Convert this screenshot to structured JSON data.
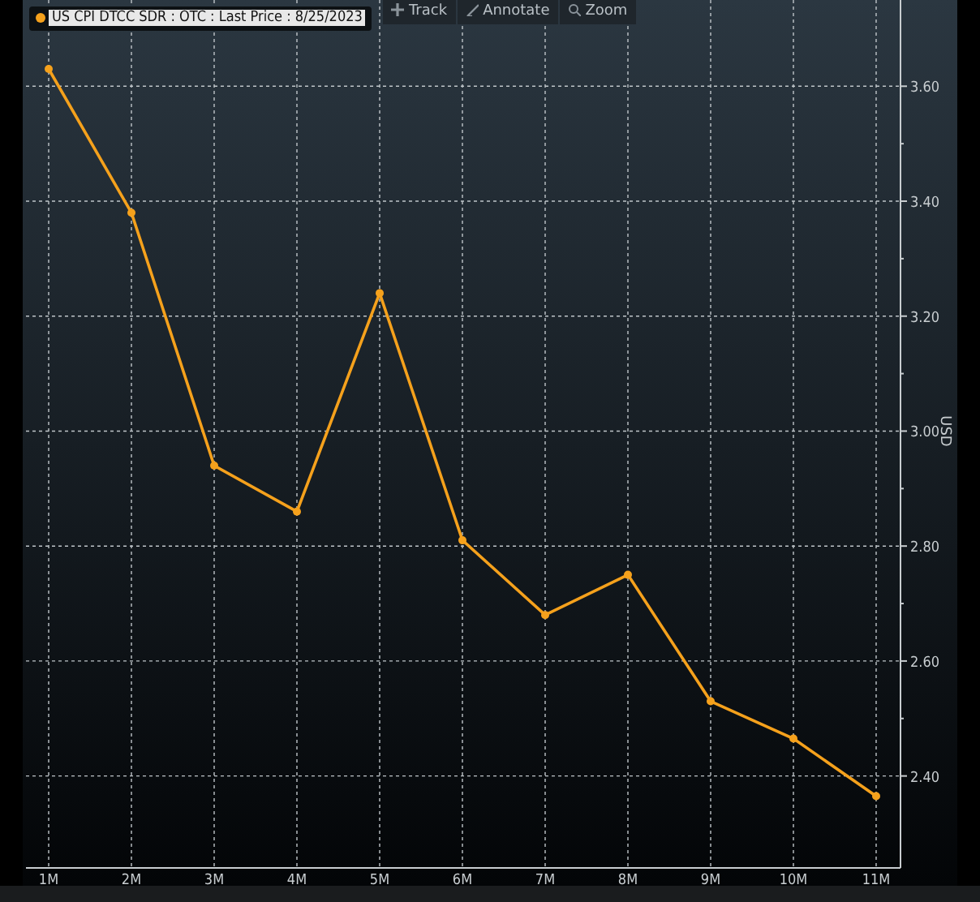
{
  "toolbar": [
    {
      "label": "Track",
      "kind": "track"
    },
    {
      "label": "Annotate",
      "kind": "annotate"
    },
    {
      "label": "Zoom",
      "kind": "zoom"
    }
  ],
  "chart": {
    "chart_data": {
      "type": "line",
      "ylabel": "USD",
      "grid": true,
      "categories": [
        "1M",
        "2M",
        "3M",
        "4M",
        "5M",
        "6M",
        "7M",
        "8M",
        "9M",
        "10M",
        "11M"
      ],
      "series": [
        {
          "name": "US CPI DTCC SDR : OTC : Last Price : 8/25/2023",
          "color": "#f5a11c",
          "marker": "circle",
          "values": [
            3.63,
            3.38,
            2.94,
            2.86,
            3.24,
            2.81,
            2.68,
            2.75,
            2.53,
            2.465,
            2.365
          ]
        }
      ],
      "ylim": [
        2.24,
        3.75
      ],
      "yticks": [
        {
          "value": 2.4,
          "label": "2.40"
        },
        {
          "value": 2.6,
          "label": "2.60"
        },
        {
          "value": 2.8,
          "label": "2.80"
        },
        {
          "value": 3.0,
          "label": "3.00"
        },
        {
          "value": 3.2,
          "label": "3.20"
        },
        {
          "value": 3.4,
          "label": "3.40"
        },
        {
          "value": 3.6,
          "label": "3.60"
        }
      ]
    }
  }
}
